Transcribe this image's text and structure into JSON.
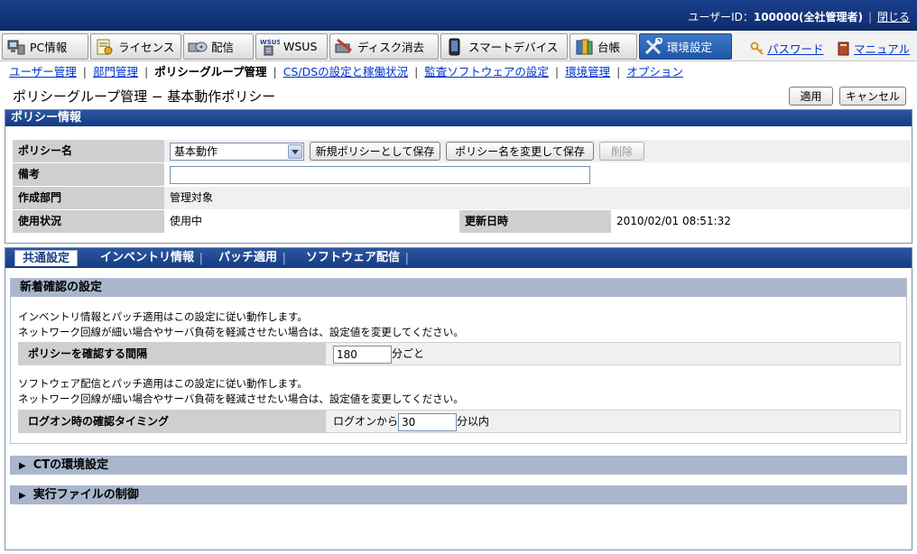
{
  "header": {
    "user_label": "ユーザーID：",
    "user_id": "100000(全社管理者)",
    "logout": "閉じる"
  },
  "main_tabs": [
    {
      "label": "PC情報",
      "icon": "pc-icon"
    },
    {
      "label": "ライセンス",
      "icon": "license-icon"
    },
    {
      "label": "配信",
      "icon": "distribution-icon"
    },
    {
      "label": "WSUS",
      "icon": "wsus-icon"
    },
    {
      "label": "ディスク消去",
      "icon": "disk-erase-icon"
    },
    {
      "label": "スマートデバイス",
      "icon": "smart-device-icon"
    },
    {
      "label": "台帳",
      "icon": "ledger-icon"
    },
    {
      "label": "環境設定",
      "icon": "settings-icon",
      "active": true
    }
  ],
  "right_links": {
    "password": "パスワード",
    "manual": "マニュアル"
  },
  "sub_nav": [
    "ユーザー管理",
    "部門管理",
    "ポリシーグループ管理",
    "CS/DSの設定と稼働状況",
    "監査ソフトウェアの設定",
    "環境管理",
    "オプション"
  ],
  "page": {
    "title": "ポリシーグループ管理 − 基本動作ポリシー",
    "apply": "適用",
    "cancel": "キャンセル"
  },
  "policy_info": {
    "heading": "ポリシー情報",
    "policy_name_label": "ポリシー名",
    "policy_name_value": "基本動作",
    "save_new": "新規ポリシーとして保存",
    "save_rename": "ポリシー名を変更して保存",
    "delete": "削除",
    "remarks_label": "備考",
    "remarks_value": "",
    "dept_label": "作成部門",
    "dept_value": "管理対象",
    "status_label": "使用状況",
    "status_value": "使用中",
    "updated_label": "更新日時",
    "updated_value": "2010/02/01 08:51:32"
  },
  "content_tabs": [
    "共通設定",
    "インベントリ情報",
    "パッチ適用",
    "ソフトウェア配信"
  ],
  "new_check": {
    "heading": "新着確認の設定",
    "note1_a": "インベントリ情報とパッチ適用はこの設定に従い動作します。",
    "note1_b": "ネットワーク回線が細い場合やサーバ負荷を軽減させたい場合は、設定値を変更してください。",
    "interval_label": "ポリシーを確認する間隔",
    "interval_value": "180",
    "interval_unit": "分ごと",
    "note2_a": "ソフトウェア配信とパッチ適用はこの設定に従い動作します。",
    "note2_b": "ネットワーク回線が細い場合やサーバ負荷を軽減させたい場合は、設定値を変更してください。",
    "logon_label": "ログオン時の確認タイミング",
    "logon_prefix": "ログオンから",
    "logon_value": "30",
    "logon_unit": "分以内"
  },
  "collapsed_sections": [
    "CTの環境設定",
    "実行ファイルの制御"
  ]
}
